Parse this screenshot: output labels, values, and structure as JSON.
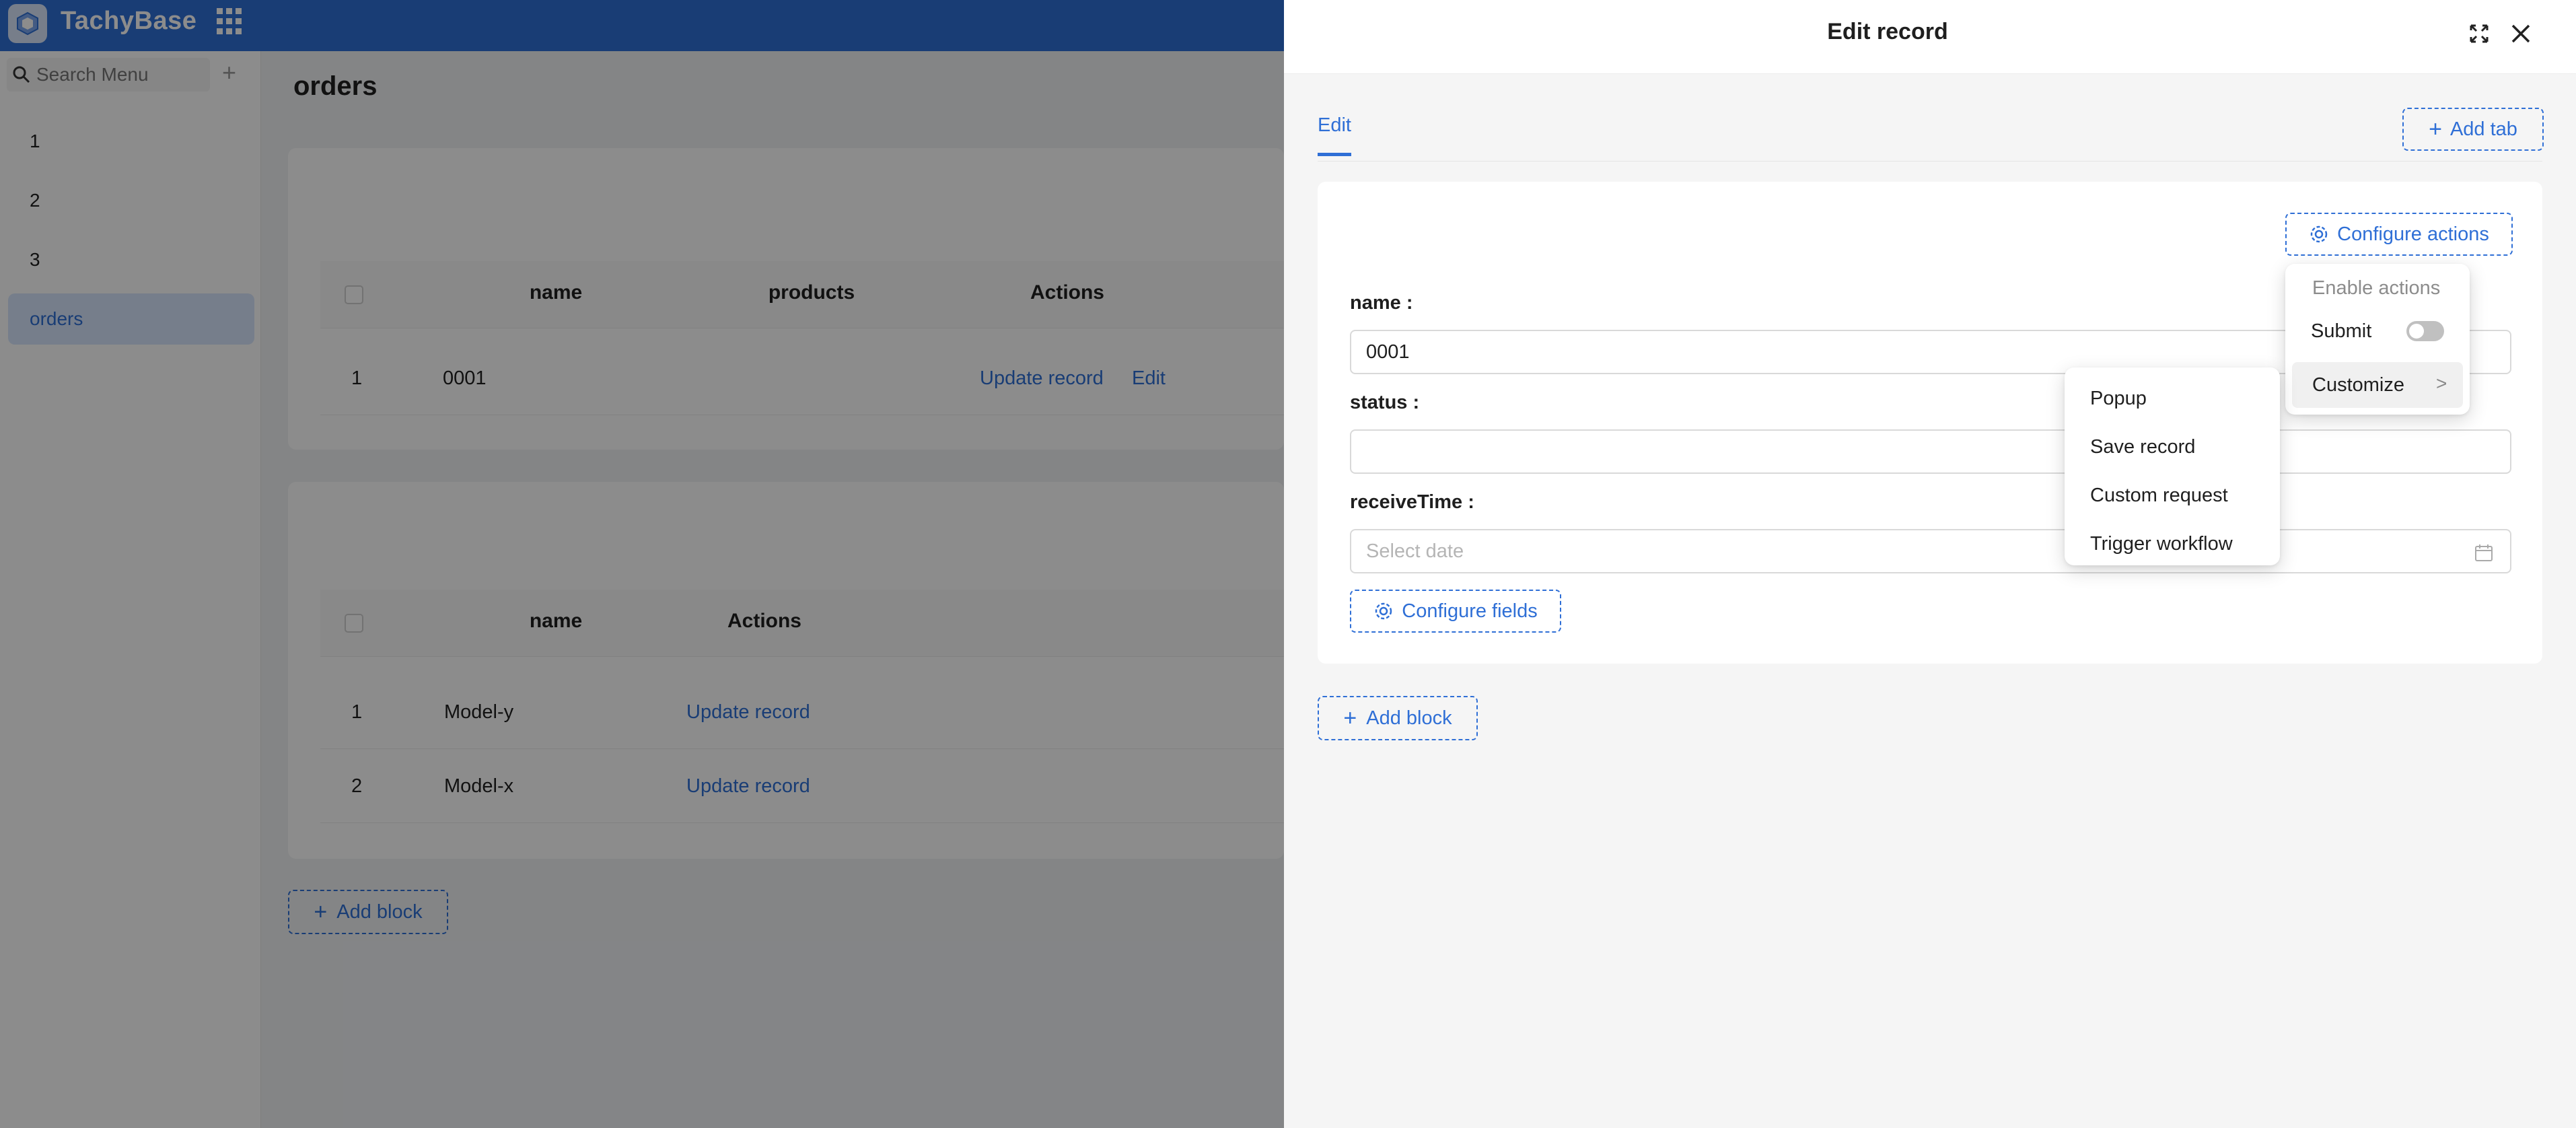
{
  "app": {
    "brand": "TachyBase",
    "search_placeholder": "Search Menu",
    "menu": [
      "1",
      "2",
      "3",
      "orders"
    ],
    "active_menu": "orders"
  },
  "page": {
    "title": "orders",
    "table1": {
      "headers": [
        "name",
        "products",
        "Actions"
      ],
      "rows": [
        {
          "index": "1",
          "name": "0001",
          "actions": [
            "Update record",
            "Edit"
          ]
        }
      ]
    },
    "table2": {
      "headers": [
        "name",
        "Actions"
      ],
      "rows": [
        {
          "index": "1",
          "name": "Model-y",
          "actions": [
            "Update record"
          ]
        },
        {
          "index": "2",
          "name": "Model-x",
          "actions": [
            "Update record"
          ]
        }
      ]
    },
    "add_block_label": "Add block"
  },
  "drawer": {
    "title": "Edit record",
    "tab_label": "Edit",
    "add_tab_label": "Add tab",
    "configure_actions_label": "Configure actions",
    "fields": [
      {
        "label": "name",
        "value": "0001",
        "placeholder": ""
      },
      {
        "label": "status",
        "value": "",
        "placeholder": ""
      },
      {
        "label": "receiveTime",
        "value": "",
        "placeholder": "Select date"
      }
    ],
    "configure_fields_label": "Configure fields",
    "add_block_label": "Add block"
  },
  "actions_menu": {
    "group_title": "Enable actions",
    "submit_label": "Submit",
    "submit_enabled": false,
    "customize_label": "Customize"
  },
  "customize_submenu": {
    "items": [
      "Popup",
      "Save record",
      "Custom request",
      "Trigger workflow"
    ]
  },
  "colors": {
    "primary": "#2f6fd6",
    "topbar": "#2f6fd6",
    "active_menu_bg": "#d7e6fd"
  }
}
